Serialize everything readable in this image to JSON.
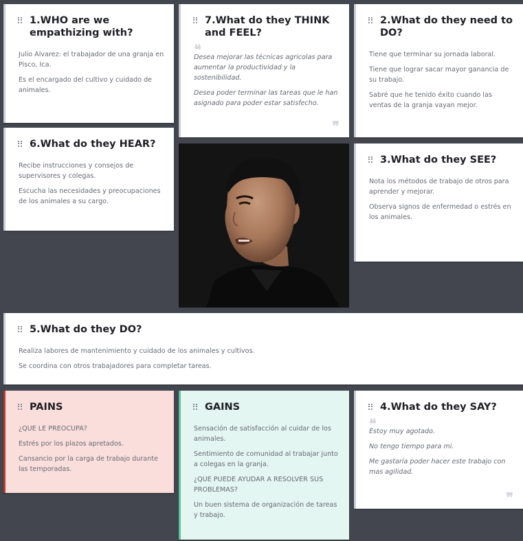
{
  "cards": {
    "who": {
      "title": "1.WHO are we empathizing with?",
      "lines": [
        "Julio Alvarez: el trabajador de una granja en Pisco, Ica.",
        "Es el encargado del cultivo y cuidado de animales."
      ]
    },
    "think": {
      "title": "7.What do they THINK and FEEL?",
      "lines": [
        "Desea mejorar las técnicas agricolas para aumentar la productividad y la sostenibilidad.",
        "Desea poder terminar las tareas que le han asignado para poder estar satisfecho."
      ]
    },
    "need": {
      "title": "2.What do they need to DO?",
      "lines": [
        "Tiene que terminar su jornada laboral.",
        "Tiene que lograr sacar mayor ganancia de su trabajo.",
        "Sabré que he tenido éxito cuando las ventas de la granja vayan mejor."
      ]
    },
    "hear": {
      "title": "6.What do they HEAR?",
      "lines": [
        "Recibe instrucciones y consejos de supervisores y colegas.",
        "Escucha las necesidades y preocupaciones de los animales a su cargo."
      ]
    },
    "see": {
      "title": "3.What do they SEE?",
      "lines": [
        "Nota los métodos de trabajo de otros para aprender y mejorar.",
        "Observa signos de enfermedad o estrés en los animales."
      ]
    },
    "do": {
      "title": "5.What do they DO?",
      "lines": [
        "Realiza labores de mantenimiento y cuidado de los animales y cultivos.",
        "Se coordina con otros trabajadores para completar tareas."
      ]
    },
    "pains": {
      "title": "PAINS",
      "lines": [
        "¿QUE LE PREOCUPA?",
        "Estrés por los plazos apretados.",
        "Cansancio por la carga de trabajo durante las temporadas."
      ]
    },
    "gains": {
      "title": "GAINS",
      "lines": [
        "Sensación de satisfacción al cuidar de los animales.",
        "Sentimiento de comunidad al trabajar junto a colegas en la granja.",
        "¿QUE PUEDE AYUDAR A RESOLVER SUS PROBLEMAS?",
        "Un buen sistema de organización de tareas y trabajo."
      ]
    },
    "say": {
      "title": "4.What do they SAY?",
      "lines": [
        "Estoy muy agotado.",
        "No tengo tiempo para mi.",
        "Me gastaría poder hacer este trabajo con mas agilidad."
      ]
    }
  },
  "icons": {
    "handle": "drag-handle-icon",
    "quote_open": "quote-open-icon",
    "quote_close": "quote-close-icon"
  },
  "colors": {
    "background": "#43464e",
    "pains_accent": "#c0392b",
    "pains_fill": "#fadedb",
    "gains_accent": "#5cc2a2",
    "gains_fill": "#e3f6f1"
  }
}
